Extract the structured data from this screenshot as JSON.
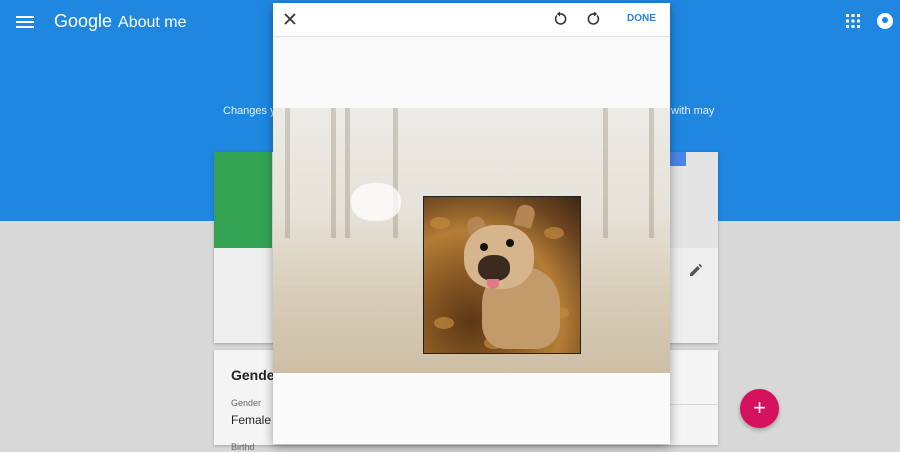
{
  "header": {
    "brand_google": "Google",
    "brand_title": "About me",
    "intro_left": "Changes y",
    "intro_right": "with may"
  },
  "gender_card": {
    "title": "Gender",
    "field_label": "Gender",
    "field_value": "Female",
    "next_label": "Birthd"
  },
  "dialog": {
    "done_label": "DONE",
    "rotate_left_icon": "rotate-left-icon",
    "rotate_right_icon": "rotate-right-icon",
    "close_icon": "close-icon"
  },
  "fab": {
    "icon": "+"
  },
  "colors": {
    "header_blue": "#1f87e0",
    "fab_pink": "#d5105d",
    "accent_green": "#33a353",
    "done_blue": "#2e7ed8"
  }
}
